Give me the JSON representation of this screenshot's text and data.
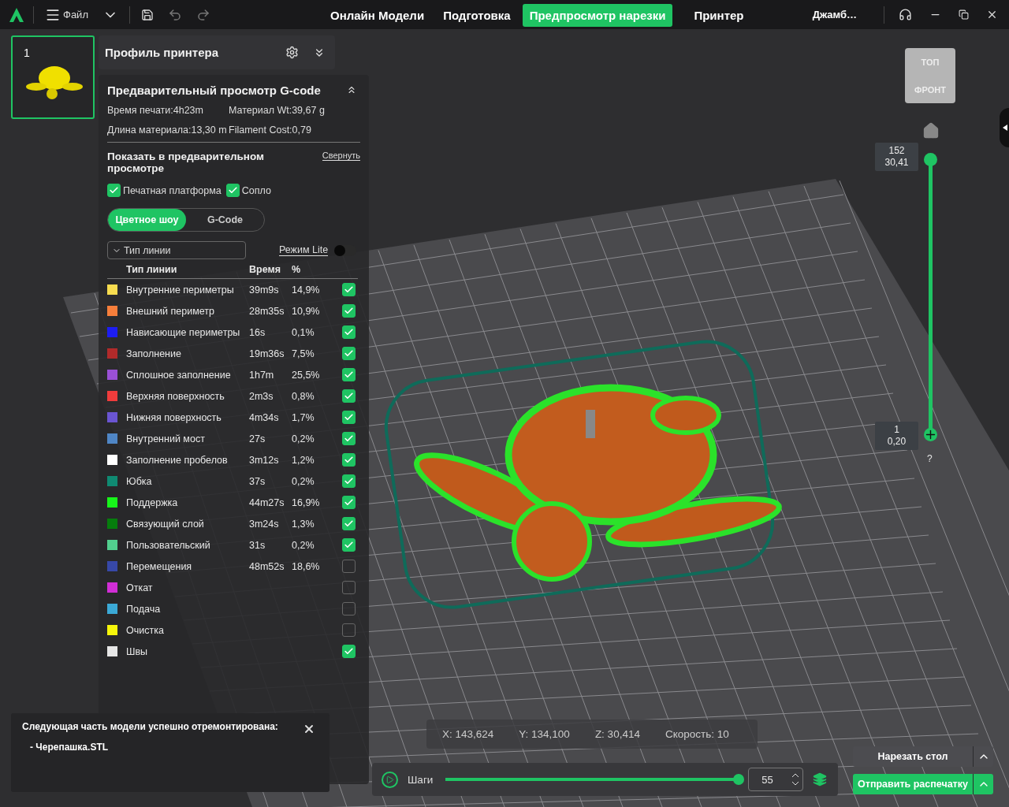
{
  "title_bar": {
    "menu_label": "Файл",
    "tabs": [
      {
        "label": "Онлайн Модели",
        "selected": false
      },
      {
        "label": "Подготовка",
        "selected": false
      },
      {
        "label": "Предпросмотр нарезки",
        "selected": true
      },
      {
        "label": "Принтер",
        "selected": false
      }
    ],
    "user": "Джамб…"
  },
  "plate": {
    "number": "1"
  },
  "printer_profile": {
    "title": "Профиль принтера"
  },
  "gcode_preview": {
    "title": "Предварительный просмотр G-code",
    "stats": [
      {
        "label": "Время печати:4h23m"
      },
      {
        "label": "Материал Wt:39,67 g"
      },
      {
        "label": "Длина материала:13,30 m"
      },
      {
        "label": "Filament Cost:0,79"
      }
    ],
    "show_title": "Показать в предварительном просмотре",
    "collapse_link": "Свернуть",
    "options": [
      {
        "label": "Печатная платформа",
        "checked": true
      },
      {
        "label": "Сопло",
        "checked": true
      }
    ],
    "view_modes": [
      {
        "label": "Цветное шоу",
        "selected": true
      },
      {
        "label": "G-Code",
        "selected": false
      }
    ],
    "dropdown": "Тип линии",
    "lite_mode": {
      "label": "Режим Lite",
      "on": false
    },
    "columns": [
      "Тип линии",
      "Время",
      "%"
    ],
    "rows": [
      {
        "name": "Внутренние периметры",
        "time": "39m9s",
        "percent": "14,9%",
        "color": "#f7dc4f",
        "checked": true
      },
      {
        "name": "Внешний периметр",
        "time": "28m35s",
        "percent": "10,9%",
        "color": "#f77f3b",
        "checked": true
      },
      {
        "name": "Нависающие периметры",
        "time": "16s",
        "percent": "0,1%",
        "color": "#1d1df2",
        "checked": true
      },
      {
        "name": "Заполнение",
        "time": "19m36s",
        "percent": "7,5%",
        "color": "#b12a2a",
        "checked": true
      },
      {
        "name": "Сплошное заполнение",
        "time": "1h7m",
        "percent": "25,5%",
        "color": "#9a50d6",
        "checked": true
      },
      {
        "name": "Верхняя поверхность",
        "time": "2m3s",
        "percent": "0,8%",
        "color": "#f03c3c",
        "checked": true
      },
      {
        "name": "Нижняя поверхность",
        "time": "4m34s",
        "percent": "1,7%",
        "color": "#6a55d2",
        "checked": true
      },
      {
        "name": "Внутренний мост",
        "time": "27s",
        "percent": "0,2%",
        "color": "#4f86c6",
        "checked": true
      },
      {
        "name": "Заполнение пробелов",
        "time": "3m12s",
        "percent": "1,2%",
        "color": "#ffffff",
        "checked": true
      },
      {
        "name": "Юбка",
        "time": "37s",
        "percent": "0,2%",
        "color": "#0f8a72",
        "checked": true
      },
      {
        "name": "Поддержка",
        "time": "44m27s",
        "percent": "16,9%",
        "color": "#17f51a",
        "checked": true
      },
      {
        "name": "Связующий слой",
        "time": "3m24s",
        "percent": "1,3%",
        "color": "#067d0d",
        "checked": true
      },
      {
        "name": "Пользовательский",
        "time": "31s",
        "percent": "0,2%",
        "color": "#52cf8e",
        "checked": true
      },
      {
        "name": "Перемещения",
        "time": "48m52s",
        "percent": "18,6%",
        "color": "#3748a8",
        "checked": false
      },
      {
        "name": "Откат",
        "time": "",
        "percent": "",
        "color": "#d12ed6",
        "checked": false
      },
      {
        "name": "Подача",
        "time": "",
        "percent": "",
        "color": "#3ba9d6",
        "checked": false
      },
      {
        "name": "Очистка",
        "time": "",
        "percent": "",
        "color": "#f5f50a",
        "checked": false
      },
      {
        "name": "Швы",
        "time": "",
        "percent": "",
        "color": "#e6e6e6",
        "checked": true
      }
    ]
  },
  "view_cube": {
    "top": "ТОП",
    "front": "ФРОНТ"
  },
  "layer_slider": {
    "level": 1,
    "upper": [
      "152",
      "30,41"
    ],
    "lower": [
      "1",
      "0,20"
    ],
    "hint": "?"
  },
  "notification": {
    "message": "Следующая часть модели успешно отремонтирована:",
    "items": [
      "- Черепашка.STL"
    ]
  },
  "position": [
    "X: 143,624",
    "Y: 134,100",
    "Z: 30,414",
    "Скорость: 10"
  ],
  "steps": {
    "label": "Шаги",
    "level": 1,
    "value": "55"
  },
  "actions": [
    "Нарезать стол",
    "Отправить распечатку"
  ]
}
